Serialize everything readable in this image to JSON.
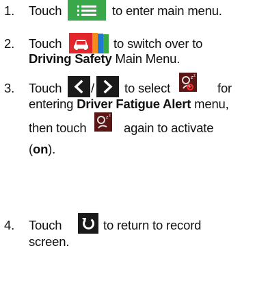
{
  "steps": [
    {
      "number": "1.",
      "line1_prefix": "Touch",
      "line1_suffix": "to enter main menu."
    },
    {
      "number": "2.",
      "line1_prefix": "Touch",
      "line1_suffix": "to switch over to",
      "line2_bold": "Driving Safety",
      "line2_rest": " Main Menu."
    },
    {
      "number": "3.",
      "line1_prefix": "Touch",
      "separator": "/",
      "line1_mid": "to select",
      "line1_suffix": "for",
      "line2_pre": "entering ",
      "line2_bold": "Driver Fatigue Alert",
      "line2_post": " menu,",
      "line3_prefix": "then touch",
      "line3_suffix": "again to activate",
      "line4_open": "(",
      "line4_bold": "on",
      "line4_close": ")."
    },
    {
      "number": "4.",
      "line1_prefix": "Touch",
      "line1_suffix": "to return to record",
      "line2": "screen."
    }
  ],
  "icons": {
    "menu": "menu-list-icon",
    "driving_safety": "car-tab-icon",
    "prev": "chevron-left-icon",
    "next": "chevron-right-icon",
    "fatigue": "driver-fatigue-icon",
    "return": "return-icon"
  },
  "colors": {
    "menu_green": "#38a84a",
    "tab_red": "#e3262c",
    "tab_orange": "#f28c1a",
    "tab_blue": "#1f7ad1",
    "tab_green": "#3aa845",
    "fatigue_bg": "#5a1515",
    "dark_button": "#1a1a1a"
  }
}
